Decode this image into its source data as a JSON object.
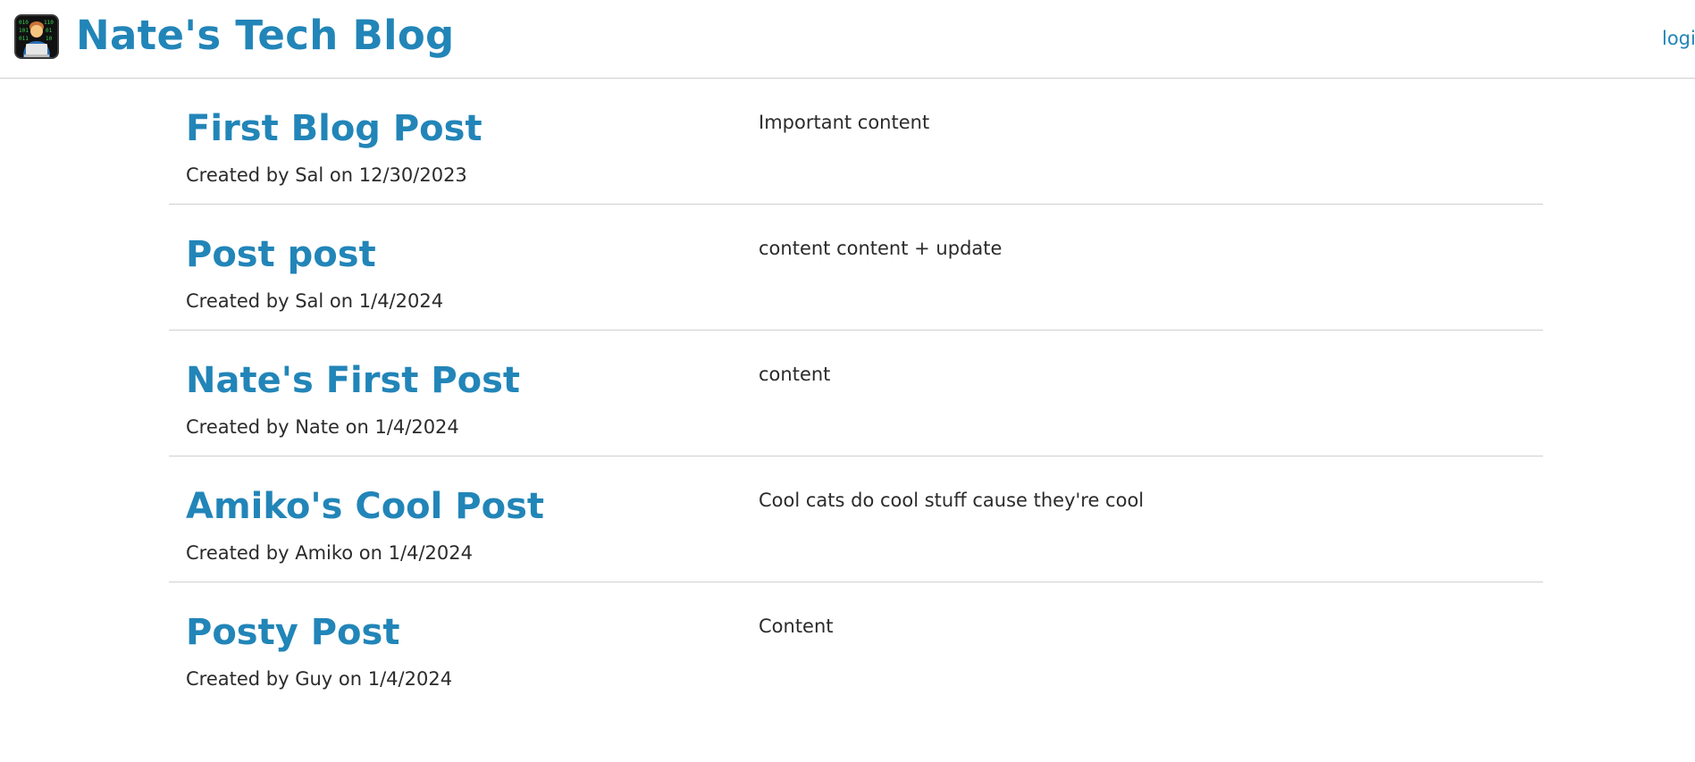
{
  "header": {
    "title": "Nate's Tech Blog",
    "login_label": "login",
    "logo_icon": "developer-emoji-icon"
  },
  "posts": [
    {
      "title": "First Blog Post",
      "meta": "Created by Sal on 12/30/2023",
      "content": "Important content"
    },
    {
      "title": "Post post",
      "meta": "Created by Sal on 1/4/2024",
      "content": "content content + update"
    },
    {
      "title": "Nate's First Post",
      "meta": "Created by Nate on 1/4/2024",
      "content": "content"
    },
    {
      "title": "Amiko's Cool Post",
      "meta": "Created by Amiko on 1/4/2024",
      "content": "Cool cats do cool stuff cause they're cool"
    },
    {
      "title": "Posty Post",
      "meta": "Created by Guy on 1/4/2024",
      "content": "Content"
    }
  ],
  "colors": {
    "accent": "#2285b8",
    "text": "#2b2b2b",
    "divider": "#d0d0d0"
  }
}
